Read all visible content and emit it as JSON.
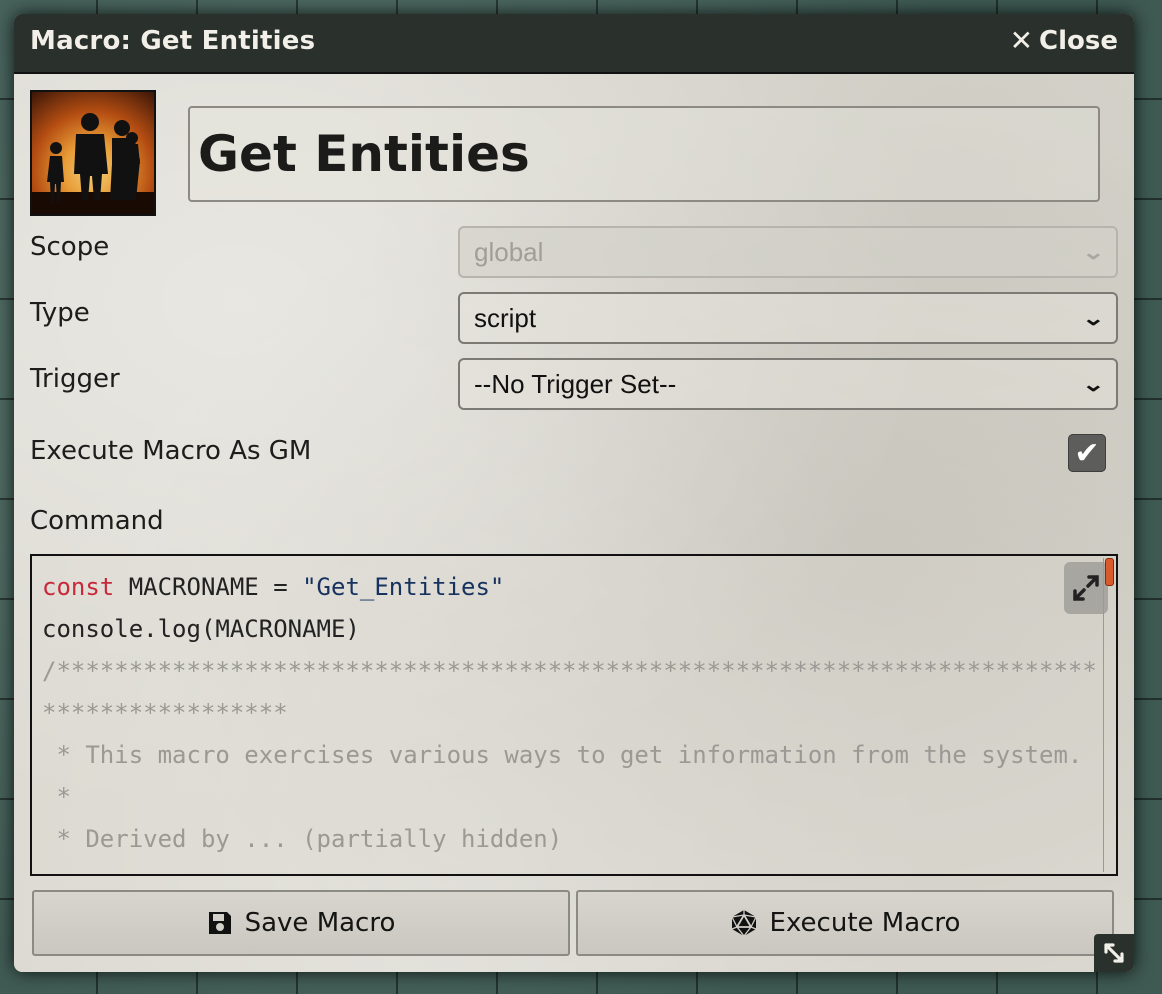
{
  "window": {
    "title": "Macro: Get Entities",
    "close_label": "Close"
  },
  "macro": {
    "name": "Get Entities",
    "avatar_icon": "family-silhouette-sunset-icon"
  },
  "fields": {
    "scope": {
      "label": "Scope",
      "value": "global",
      "disabled": true
    },
    "type": {
      "label": "Type",
      "value": "script"
    },
    "trigger": {
      "label": "Trigger",
      "value": "--No Trigger Set--"
    },
    "execute_as_gm": {
      "label": "Execute Macro As GM",
      "checked": true
    },
    "command_label": "Command"
  },
  "command": {
    "lines": [
      {
        "kw": "const",
        "text": " MACRONAME = ",
        "str": "\"Get_Entities\""
      },
      {
        "text": "console.log(MACRONAME)"
      },
      {
        "comment": "/*****************************************************************************************"
      },
      {
        "comment": " * This macro exercises various ways to get information from the system."
      },
      {
        "comment": " *"
      },
      {
        "comment": " * Derived by ... (partially hidden)"
      }
    ]
  },
  "buttons": {
    "save_label": "Save Macro",
    "execute_label": "Execute Macro"
  },
  "colors": {
    "titlebar": "#2a302c",
    "keyword": "#c8293a",
    "string": "#17325e",
    "comment": "#9a9994"
  }
}
